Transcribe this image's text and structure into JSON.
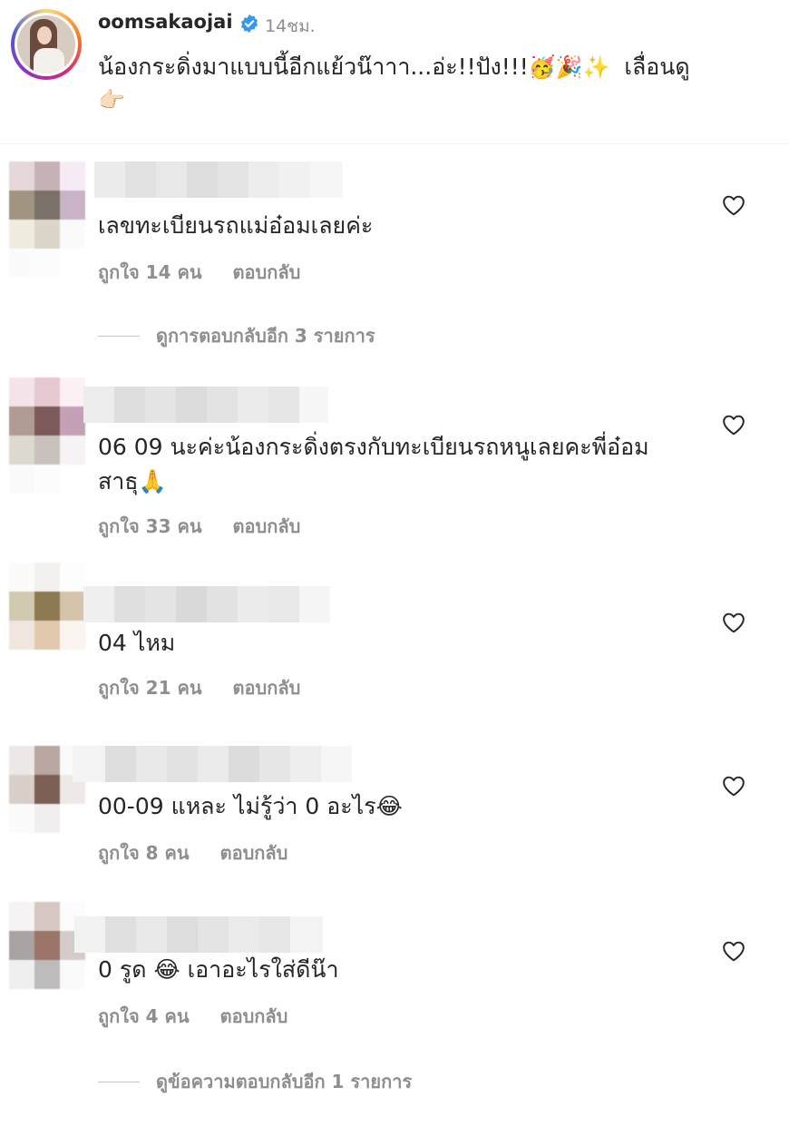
{
  "post": {
    "username": "oomsakaojai",
    "time": "14ชม.",
    "caption_text": "น้องกระดิ่งมาแบบนี้อีกแย้วน๊าาา...อ่ะ!!ปัง!!!",
    "caption_emojis": "🥳🎉✨",
    "caption_more": "เลื่อนดู",
    "caption_pointer": "👉🏻"
  },
  "comments": [
    {
      "text": "เลขทะเบียนรถแม่อ๋อมเลยค่ะ",
      "likes": "ถูกใจ 14 คน",
      "reply": "ตอบกลับ",
      "view_replies": "ดูการตอบกลับอีก 3 รายการ"
    },
    {
      "text": "06 09 นะค่ะน้องกระดิ่งตรงกับทะเบียนรถหนูเลยคะพี่อ๋อม สาธุ🙏",
      "likes": "ถูกใจ 33 คน",
      "reply": "ตอบกลับ"
    },
    {
      "text": "04 ไหม",
      "likes": "ถูกใจ 21 คน",
      "reply": "ตอบกลับ"
    },
    {
      "text": "00-09 แหละ ไม่รู้ว่า 0 อะไร😂",
      "likes": "ถูกใจ 8 คน",
      "reply": "ตอบกลับ"
    },
    {
      "text": "0 รูด 😂 เอาอะไรใส่ดีน๊า",
      "likes": "ถูกใจ 4 คน",
      "reply": "ตอบกลับ",
      "view_replies": "ดูข้อความตอบกลับอีก 1 รายการ"
    }
  ],
  "icons": {
    "verified": "verified-badge-icon",
    "like": "heart-outline-icon"
  },
  "colors": {
    "verified": "#3897f0",
    "muted": "#8e8e8e",
    "text": "#262626"
  }
}
